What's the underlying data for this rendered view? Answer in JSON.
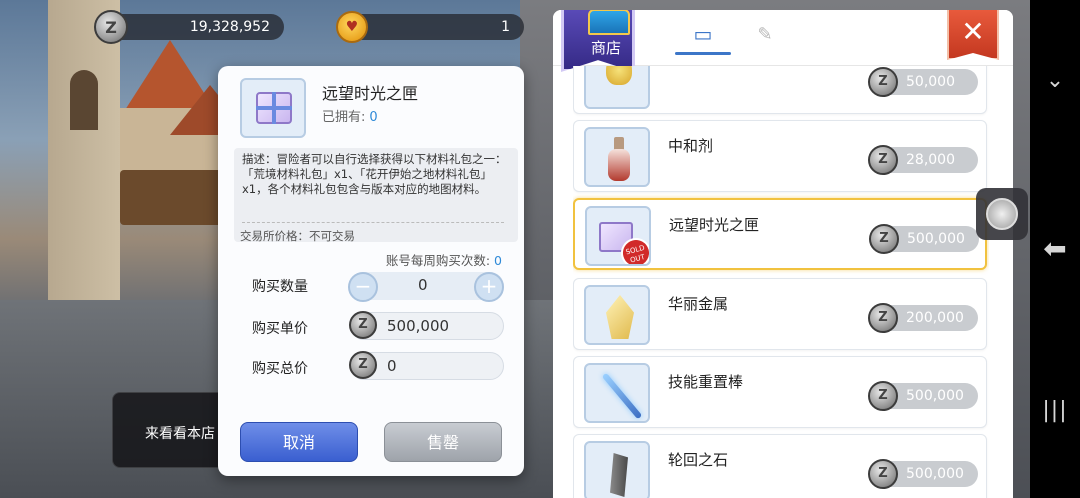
{
  "hud": {
    "zeny_amount": "19,328,952",
    "cat_coin_amount": "1"
  },
  "background": {
    "chat_preview": "来看看本店"
  },
  "purchase_dialog": {
    "item_name": "远望时光之匣",
    "owned_label": "已拥有:",
    "owned_count": "0",
    "description": "描述：冒险者可以自行选择获得以下材料礼包之一：「荒境材料礼包」x1、「花开伊始之地材料礼包」x1，各个材料礼包包含与版本对应的地图材料。",
    "trade_price": "交易所价格：不可交易",
    "weekly_limit_label": "账号每周购买次数:",
    "weekly_limit_value": "0",
    "quantity_label": "购买数量",
    "quantity_value": "0",
    "unit_price_label": "购买单价",
    "unit_price_value": "500,000",
    "total_price_label": "购买总价",
    "total_price_value": "0",
    "cancel_label": "取消",
    "sell_label": "售罄"
  },
  "shop": {
    "badge_label": "商店",
    "tabs": [
      {
        "icon": "shop-icon",
        "active": true
      },
      {
        "icon": "tool-icon",
        "active": false
      }
    ],
    "items": [
      {
        "name": "",
        "price": "50,000",
        "icon": "bell-item-icon",
        "selected": false
      },
      {
        "name": "中和剂",
        "price": "28,000",
        "icon": "potion-bottle-icon",
        "selected": false
      },
      {
        "name": "远望时光之匣",
        "price": "500,000",
        "icon": "gift-box-icon",
        "selected": true,
        "sold_out": "SOLD OUT"
      },
      {
        "name": "华丽金属",
        "price": "200,000",
        "icon": "crystal-metal-icon",
        "selected": false
      },
      {
        "name": "技能重置棒",
        "price": "500,000",
        "icon": "skill-reset-rod-icon",
        "selected": false
      },
      {
        "name": "轮回之石",
        "price": "500,000",
        "icon": "reincarnation-stone-icon",
        "selected": false
      }
    ]
  },
  "colors": {
    "accent_blue": "#3c76c8",
    "cancel_button": "#3a5fd0",
    "selected_border": "#f1c23f",
    "close_button": "#c43820"
  }
}
